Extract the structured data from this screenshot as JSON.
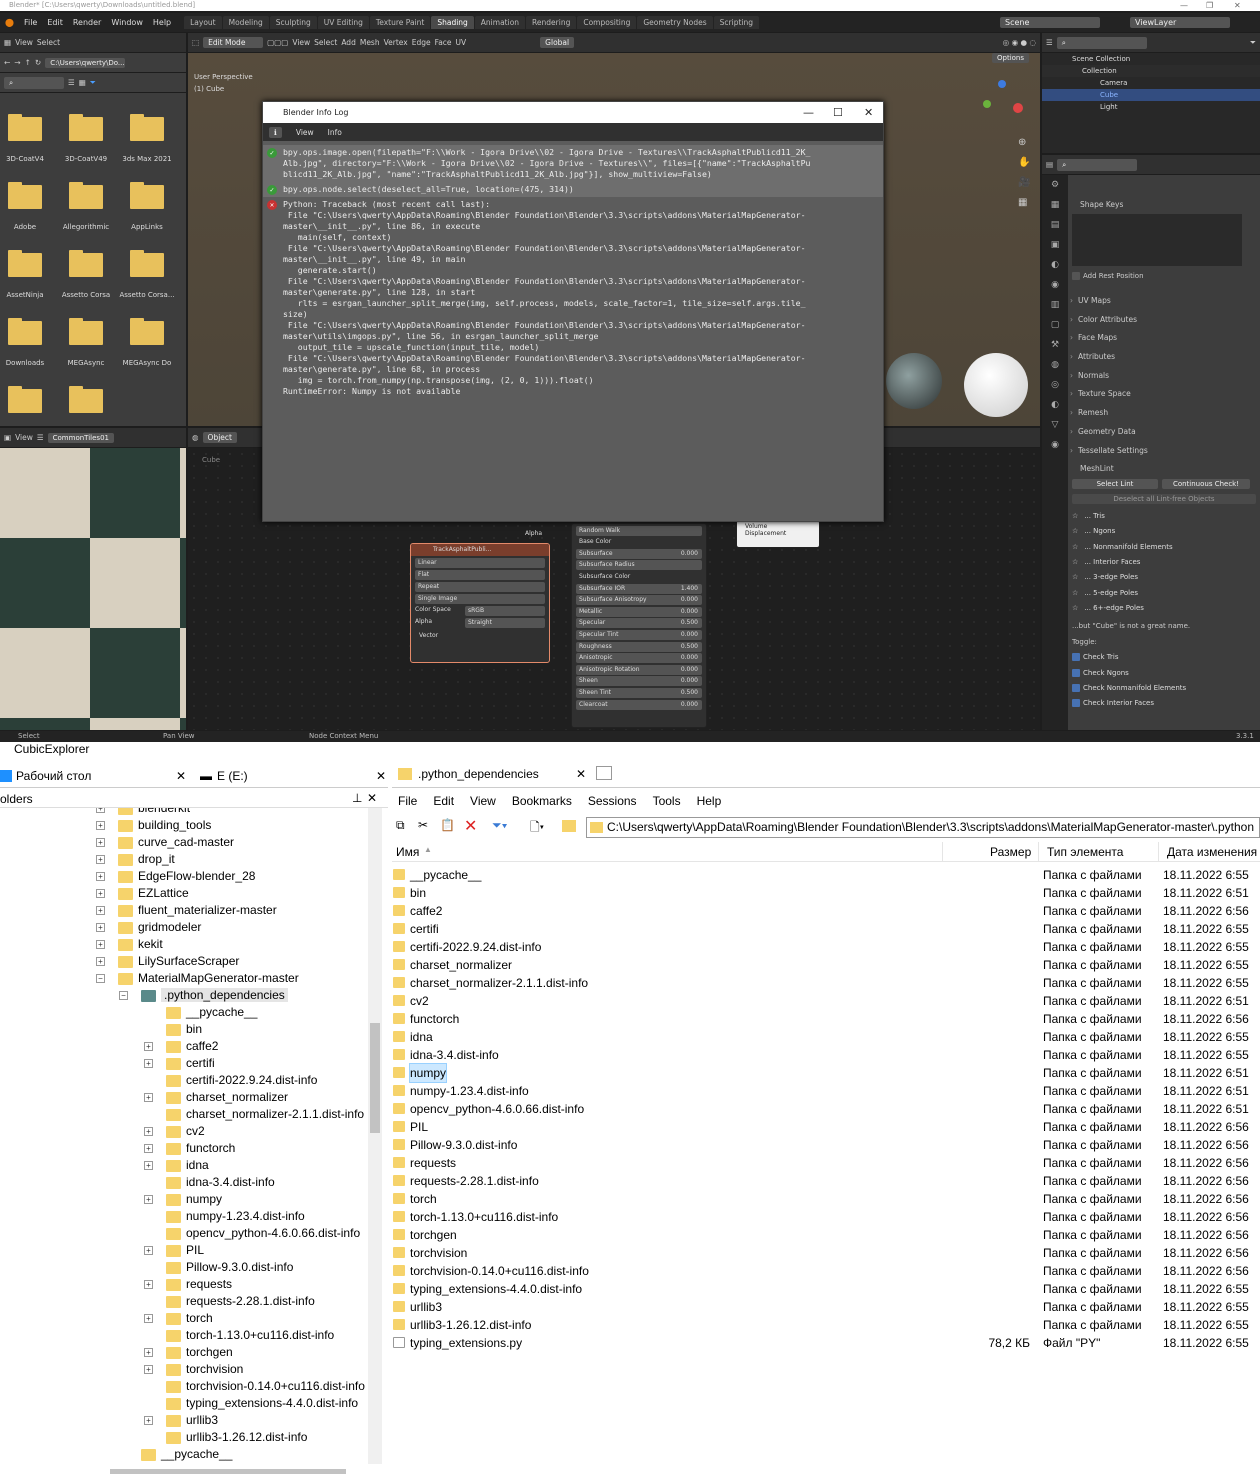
{
  "blender": {
    "title": "Blender* [C:\\Users\\qwerty\\Downloads\\untitled.blend]",
    "menus": [
      "File",
      "Edit",
      "Render",
      "Window",
      "Help"
    ],
    "workspaces": [
      "Layout",
      "Modeling",
      "Sculpting",
      "UV Editing",
      "Texture Paint",
      "Shading",
      "Animation",
      "Rendering",
      "Compositing",
      "Geometry Nodes",
      "Scripting"
    ],
    "active_workspace": "Shading",
    "scene": "Scene",
    "view_layer": "ViewLayer",
    "filebrowser": {
      "menus": [
        "View",
        "Select"
      ],
      "path": "C:\\Users\\qwerty\\Do...",
      "folders": [
        "3D-CoatV4",
        "3D-CoatV49",
        "3ds Max 2021",
        "Adobe",
        "Allegorithmic",
        "AppLinks",
        "AssetNinja",
        "Assetto Corsa",
        "Assetto Corsa...",
        "Downloads",
        "MEGAsync",
        "MEGAsync Do",
        "",
        ""
      ]
    },
    "viewport": {
      "mode": "Edit Mode",
      "menus": [
        "View",
        "Select",
        "Add",
        "Mesh",
        "Vertex",
        "Edge",
        "Face",
        "UV"
      ],
      "orientation": "Global",
      "options": "Options",
      "perspective": "User Perspective",
      "object": "(1) Cube"
    },
    "image_editor": {
      "menus": [
        "View"
      ],
      "image": "CommonTiles01"
    },
    "node_editor": {
      "object": "Object",
      "breadcrumb": "Cube",
      "image_node": {
        "name": "TrackAsphaltPubli...",
        "interp": "Linear",
        "proj": "Flat",
        "ext": "Repeat",
        "src": "Single Image",
        "colorspace_label": "Color Space",
        "colorspace": "sRGB",
        "alpha_label": "Alpha",
        "alpha": "Straight",
        "vector": "Vector",
        "out_alpha": "Alpha"
      },
      "bsdf_rows": [
        {
          "label": "Random Walk",
          "value": ""
        },
        {
          "label": "Base Color",
          "value": ""
        },
        {
          "label": "Subsurface",
          "value": "0.000"
        },
        {
          "label": "Subsurface Radius",
          "value": ""
        },
        {
          "label": "Subsurface Color",
          "value": ""
        },
        {
          "label": "Subsurface IOR",
          "value": "1.400"
        },
        {
          "label": "Subsurface Anisotropy",
          "value": "0.000"
        },
        {
          "label": "Metallic",
          "value": "0.000"
        },
        {
          "label": "Specular",
          "value": "0.500"
        },
        {
          "label": "Specular Tint",
          "value": "0.000"
        },
        {
          "label": "Roughness",
          "value": "0.500"
        },
        {
          "label": "Anisotropic",
          "value": "0.000"
        },
        {
          "label": "Anisotropic Rotation",
          "value": "0.000"
        },
        {
          "label": "Sheen",
          "value": "0.000"
        },
        {
          "label": "Sheen Tint",
          "value": "0.500"
        },
        {
          "label": "Clearcoat",
          "value": "0.000"
        }
      ],
      "output_node": {
        "volume": "Volume",
        "displacement": "Displacement"
      }
    },
    "outliner": {
      "root": "Scene Collection",
      "collection": "Collection",
      "items": [
        "Camera",
        "Cube",
        "Light"
      ]
    },
    "properties": {
      "shape_keys": "Shape Keys",
      "add_rest": "Add Rest Position",
      "panels": [
        "UV Maps",
        "Color Attributes",
        "Face Maps",
        "Attributes",
        "Normals",
        "Texture Space",
        "Remesh",
        "Geometry Data",
        "Tessellate Settings"
      ],
      "meshlint": "MeshLint",
      "select_lint": "Select Lint",
      "continuous": "Continuous Check!",
      "deselect": "Deselect all Lint-free Objects",
      "checks": [
        "... Tris",
        "... Ngons",
        "... Nonmanifold Elements",
        "... Interior Faces",
        "... 3-edge Poles",
        "... 5-edge Poles",
        "... 6+-edge Poles"
      ],
      "bad_name": "...but \"Cube\" is not a great name.",
      "toggle": "Toggle:",
      "toggles": [
        "Check Tris",
        "Check Ngons",
        "Check Nonmanifold Elements",
        "Check Interior Faces"
      ]
    },
    "statusbar": {
      "select": "Select",
      "pan": "Pan View",
      "context": "Node Context Menu",
      "version": "3.3.1"
    }
  },
  "infolog": {
    "title": "Blender Info Log",
    "menus": [
      "View",
      "Info"
    ],
    "entries": [
      {
        "type": "ok",
        "selected": true,
        "lines": [
          "bpy.ops.image.open(filepath=\"F:\\\\Work - Igora Drive\\\\02 - Igora Drive - Textures\\\\TrackAsphaltPublicd11_2K_",
          "Alb.jpg\", directory=\"F:\\\\Work - Igora Drive\\\\02 - Igora Drive - Textures\\\\\", files=[{\"name\":\"TrackAsphaltPu",
          "blicd11_2K_Alb.jpg\", \"name\":\"TrackAsphaltPublicd11_2K_Alb.jpg\"}], show_multiview=False)"
        ]
      },
      {
        "type": "ok",
        "selected": true,
        "lines": [
          "bpy.ops.node.select(deselect_all=True, location=(475, 314))"
        ]
      },
      {
        "type": "err",
        "selected": false,
        "lines": [
          "Python: Traceback (most recent call last):",
          "",
          " File \"C:\\Users\\qwerty\\AppData\\Roaming\\Blender Foundation\\Blender\\3.3\\scripts\\addons\\MaterialMapGenerator-",
          "master\\__init__.py\", line 86, in execute",
          "",
          "   main(self, context)",
          "",
          " File \"C:\\Users\\qwerty\\AppData\\Roaming\\Blender Foundation\\Blender\\3.3\\scripts\\addons\\MaterialMapGenerator-",
          "master\\__init__.py\", line 49, in main",
          "",
          "   generate.start()",
          "",
          " File \"C:\\Users\\qwerty\\AppData\\Roaming\\Blender Foundation\\Blender\\3.3\\scripts\\addons\\MaterialMapGenerator-",
          "master\\generate.py\", line 128, in start",
          "",
          "   rlts = esrgan_launcher_split_merge(img, self.process, models, scale_factor=1, tile_size=self.args.tile_",
          "size)",
          "",
          " File \"C:\\Users\\qwerty\\AppData\\Roaming\\Blender Foundation\\Blender\\3.3\\scripts\\addons\\MaterialMapGenerator-",
          "master\\utils\\imgops.py\", line 56, in esrgan_launcher_split_merge",
          "",
          "   output_tile = upscale_function(input_tile, model)",
          "",
          " File \"C:\\Users\\qwerty\\AppData\\Roaming\\Blender Foundation\\Blender\\3.3\\scripts\\addons\\MaterialMapGenerator-",
          "master\\generate.py\", line 68, in process",
          "",
          "   img = torch.from_numpy(np.transpose(img, (2, 0, 1))).float()",
          "",
          "RuntimeError: Numpy is not available"
        ]
      }
    ]
  },
  "explorer": {
    "title": "CubicExplorer",
    "left_tabs": [
      "Рабочий стол",
      "E (E:)"
    ],
    "right_tab": ".python_dependencies",
    "folders_label": "olders",
    "menus": [
      "File",
      "Edit",
      "View",
      "Bookmarks",
      "Sessions",
      "Tools",
      "Help"
    ],
    "address": "C:\\Users\\qwerty\\AppData\\Roaming\\Blender Foundation\\Blender\\3.3\\scripts\\addons\\MaterialMapGenerator-master\\.python",
    "columns": {
      "name": "Имя",
      "size": "Размер",
      "type": "Тип элемента",
      "date": "Дата изменения"
    },
    "tree": [
      {
        "l": "blenderkit",
        "d": 0,
        "p": true
      },
      {
        "l": "building_tools",
        "d": 0,
        "p": true
      },
      {
        "l": "curve_cad-master",
        "d": 0,
        "p": true
      },
      {
        "l": "drop_it",
        "d": 0,
        "p": true
      },
      {
        "l": "EdgeFlow-blender_28",
        "d": 0,
        "p": true
      },
      {
        "l": "EZLattice",
        "d": 0,
        "p": true
      },
      {
        "l": "fluent_materializer-master",
        "d": 0,
        "p": true
      },
      {
        "l": "gridmodeler",
        "d": 0,
        "p": true
      },
      {
        "l": "kekit",
        "d": 0,
        "p": true
      },
      {
        "l": "LilySurfaceScraper",
        "d": 0,
        "p": true
      },
      {
        "l": "MaterialMapGenerator-master",
        "d": 0,
        "p": true
      },
      {
        "l": ".python_dependencies",
        "d": 1,
        "p": true,
        "sel": true
      },
      {
        "l": "__pycache__",
        "d": 2,
        "p": false
      },
      {
        "l": "bin",
        "d": 2,
        "p": false
      },
      {
        "l": "caffe2",
        "d": 2,
        "p": true
      },
      {
        "l": "certifi",
        "d": 2,
        "p": true
      },
      {
        "l": "certifi-2022.9.24.dist-info",
        "d": 2,
        "p": false
      },
      {
        "l": "charset_normalizer",
        "d": 2,
        "p": true
      },
      {
        "l": "charset_normalizer-2.1.1.dist-info",
        "d": 2,
        "p": false
      },
      {
        "l": "cv2",
        "d": 2,
        "p": true
      },
      {
        "l": "functorch",
        "d": 2,
        "p": true
      },
      {
        "l": "idna",
        "d": 2,
        "p": true
      },
      {
        "l": "idna-3.4.dist-info",
        "d": 2,
        "p": false
      },
      {
        "l": "numpy",
        "d": 2,
        "p": true
      },
      {
        "l": "numpy-1.23.4.dist-info",
        "d": 2,
        "p": false
      },
      {
        "l": "opencv_python-4.6.0.66.dist-info",
        "d": 2,
        "p": false
      },
      {
        "l": "PIL",
        "d": 2,
        "p": true
      },
      {
        "l": "Pillow-9.3.0.dist-info",
        "d": 2,
        "p": false
      },
      {
        "l": "requests",
        "d": 2,
        "p": true
      },
      {
        "l": "requests-2.28.1.dist-info",
        "d": 2,
        "p": false
      },
      {
        "l": "torch",
        "d": 2,
        "p": true
      },
      {
        "l": "torch-1.13.0+cu116.dist-info",
        "d": 2,
        "p": false
      },
      {
        "l": "torchgen",
        "d": 2,
        "p": true
      },
      {
        "l": "torchvision",
        "d": 2,
        "p": true
      },
      {
        "l": "torchvision-0.14.0+cu116.dist-info",
        "d": 2,
        "p": false
      },
      {
        "l": "typing_extensions-4.4.0.dist-info",
        "d": 2,
        "p": false
      },
      {
        "l": "urllib3",
        "d": 2,
        "p": true
      },
      {
        "l": "urllib3-1.26.12.dist-info",
        "d": 2,
        "p": false
      },
      {
        "l": "__pycache__",
        "d": 1,
        "p": false
      }
    ],
    "files": [
      {
        "n": "__pycache__",
        "s": "",
        "t": "Папка с файлами",
        "d": "18.11.2022 6:55"
      },
      {
        "n": "bin",
        "s": "",
        "t": "Папка с файлами",
        "d": "18.11.2022 6:51"
      },
      {
        "n": "caffe2",
        "s": "",
        "t": "Папка с файлами",
        "d": "18.11.2022 6:56"
      },
      {
        "n": "certifi",
        "s": "",
        "t": "Папка с файлами",
        "d": "18.11.2022 6:55"
      },
      {
        "n": "certifi-2022.9.24.dist-info",
        "s": "",
        "t": "Папка с файлами",
        "d": "18.11.2022 6:55"
      },
      {
        "n": "charset_normalizer",
        "s": "",
        "t": "Папка с файлами",
        "d": "18.11.2022 6:55"
      },
      {
        "n": "charset_normalizer-2.1.1.dist-info",
        "s": "",
        "t": "Папка с файлами",
        "d": "18.11.2022 6:55"
      },
      {
        "n": "cv2",
        "s": "",
        "t": "Папка с файлами",
        "d": "18.11.2022 6:51"
      },
      {
        "n": "functorch",
        "s": "",
        "t": "Папка с файлами",
        "d": "18.11.2022 6:56"
      },
      {
        "n": "idna",
        "s": "",
        "t": "Папка с файлами",
        "d": "18.11.2022 6:55"
      },
      {
        "n": "idna-3.4.dist-info",
        "s": "",
        "t": "Папка с файлами",
        "d": "18.11.2022 6:55"
      },
      {
        "n": "numpy",
        "s": "",
        "t": "Папка с файлами",
        "d": "18.11.2022 6:51",
        "sel": true
      },
      {
        "n": "numpy-1.23.4.dist-info",
        "s": "",
        "t": "Папка с файлами",
        "d": "18.11.2022 6:51"
      },
      {
        "n": "opencv_python-4.6.0.66.dist-info",
        "s": "",
        "t": "Папка с файлами",
        "d": "18.11.2022 6:51"
      },
      {
        "n": "PIL",
        "s": "",
        "t": "Папка с файлами",
        "d": "18.11.2022 6:56"
      },
      {
        "n": "Pillow-9.3.0.dist-info",
        "s": "",
        "t": "Папка с файлами",
        "d": "18.11.2022 6:56"
      },
      {
        "n": "requests",
        "s": "",
        "t": "Папка с файлами",
        "d": "18.11.2022 6:56"
      },
      {
        "n": "requests-2.28.1.dist-info",
        "s": "",
        "t": "Папка с файлами",
        "d": "18.11.2022 6:56"
      },
      {
        "n": "torch",
        "s": "",
        "t": "Папка с файлами",
        "d": "18.11.2022 6:56"
      },
      {
        "n": "torch-1.13.0+cu116.dist-info",
        "s": "",
        "t": "Папка с файлами",
        "d": "18.11.2022 6:56"
      },
      {
        "n": "torchgen",
        "s": "",
        "t": "Папка с файлами",
        "d": "18.11.2022 6:56"
      },
      {
        "n": "torchvision",
        "s": "",
        "t": "Папка с файлами",
        "d": "18.11.2022 6:56"
      },
      {
        "n": "torchvision-0.14.0+cu116.dist-info",
        "s": "",
        "t": "Папка с файлами",
        "d": "18.11.2022 6:56"
      },
      {
        "n": "typing_extensions-4.4.0.dist-info",
        "s": "",
        "t": "Папка с файлами",
        "d": "18.11.2022 6:55"
      },
      {
        "n": "urllib3",
        "s": "",
        "t": "Папка с файлами",
        "d": "18.11.2022 6:55"
      },
      {
        "n": "urllib3-1.26.12.dist-info",
        "s": "",
        "t": "Папка с файлами",
        "d": "18.11.2022 6:55"
      },
      {
        "n": "typing_extensions.py",
        "s": "78,2 КБ",
        "t": "Файл \"PY\"",
        "d": "18.11.2022 6:55",
        "file": true
      }
    ]
  }
}
